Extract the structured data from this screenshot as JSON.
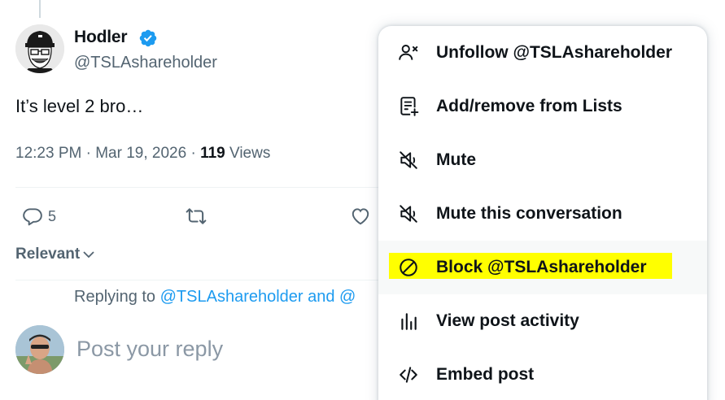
{
  "post": {
    "author_name": "Hodler",
    "author_handle": "@TSLAshareholder",
    "text": "It’s level 2 bro…",
    "timestamp": "12:23 PM · Mar 19, 2026 · ",
    "views_count": "119",
    "views_label": " Views",
    "reply_count": "5"
  },
  "sort": {
    "label": "Relevant"
  },
  "reply": {
    "replying_prefix": "Replying to ",
    "replying_link": "@TSLAshareholder and @",
    "placeholder": "Post your reply"
  },
  "menu": {
    "items": [
      {
        "label": "Unfollow @TSLAshareholder",
        "icon": "unfollow-icon"
      },
      {
        "label": "Add/remove from Lists",
        "icon": "list-add-icon"
      },
      {
        "label": "Mute",
        "icon": "mute-icon"
      },
      {
        "label": "Mute this conversation",
        "icon": "mute-conversation-icon"
      },
      {
        "label": "Block @TSLAshareholder",
        "icon": "block-icon"
      },
      {
        "label": "View post activity",
        "icon": "activity-icon"
      },
      {
        "label": "Embed post",
        "icon": "code-icon"
      }
    ]
  },
  "colors": {
    "accent": "#1d9bf0",
    "secondary_text": "#536471",
    "highlight": "#ffff00"
  }
}
